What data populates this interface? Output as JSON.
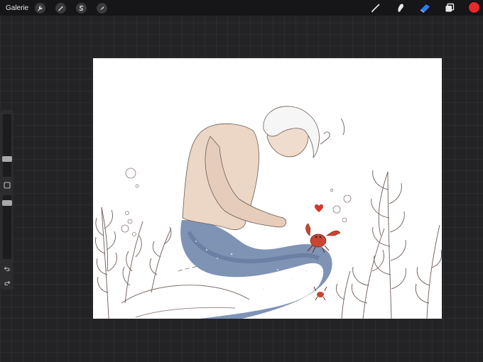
{
  "topbar": {
    "gallery_label": "Galerie",
    "left_tools": [
      "wrench-icon",
      "magic-wand-icon",
      "selection-icon",
      "transform-icon"
    ],
    "right_tools": [
      "brush-icon",
      "smudge-icon",
      "eraser-icon",
      "layers-icon"
    ],
    "active_color": "#e8282b",
    "active_tool": "eraser",
    "eraser_color": "#2f7bf5"
  },
  "sidebar": {
    "brush_size_level": 0.55,
    "opacity_level": 0.28,
    "buttons": [
      "modify-square-icon",
      "undo-icon",
      "redo-icon"
    ]
  },
  "canvas": {
    "artwork": "mermaid-with-crab-illustration"
  }
}
